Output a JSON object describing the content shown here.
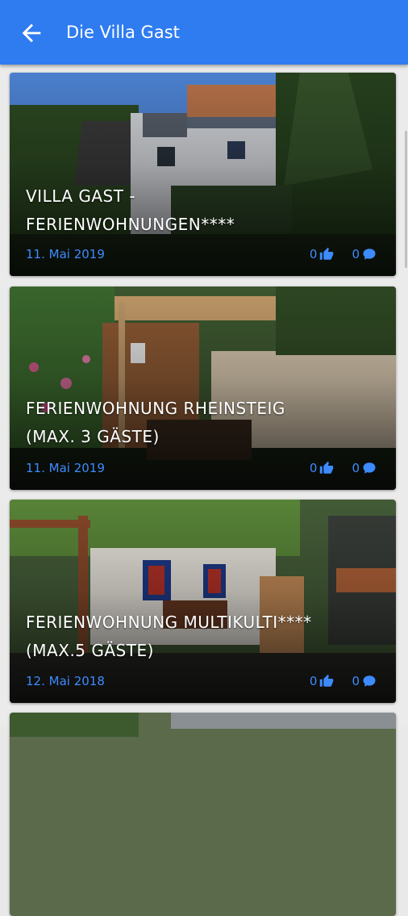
{
  "appbar": {
    "title": "Die Villa Gast",
    "back_icon": "arrow-back-icon",
    "background": "#2f7cf0"
  },
  "accent": "#3d8bff",
  "cards": [
    {
      "title_line1": "Villa Gast -",
      "title_line2": "Ferienwohnungen****",
      "date": "11. Mai 2019",
      "likes": "0",
      "comments": "0"
    },
    {
      "title_line1": "Ferienwohnung Rheinsteig",
      "title_line2": "(Max. 3 Gäste)",
      "date": "11. Mai 2019",
      "likes": "0",
      "comments": "0"
    },
    {
      "title_line1": "Ferienwohnung Multikulti****",
      "title_line2": "(Max.5 Gäste)",
      "date": "12. Mai 2018",
      "likes": "0",
      "comments": "0"
    }
  ]
}
